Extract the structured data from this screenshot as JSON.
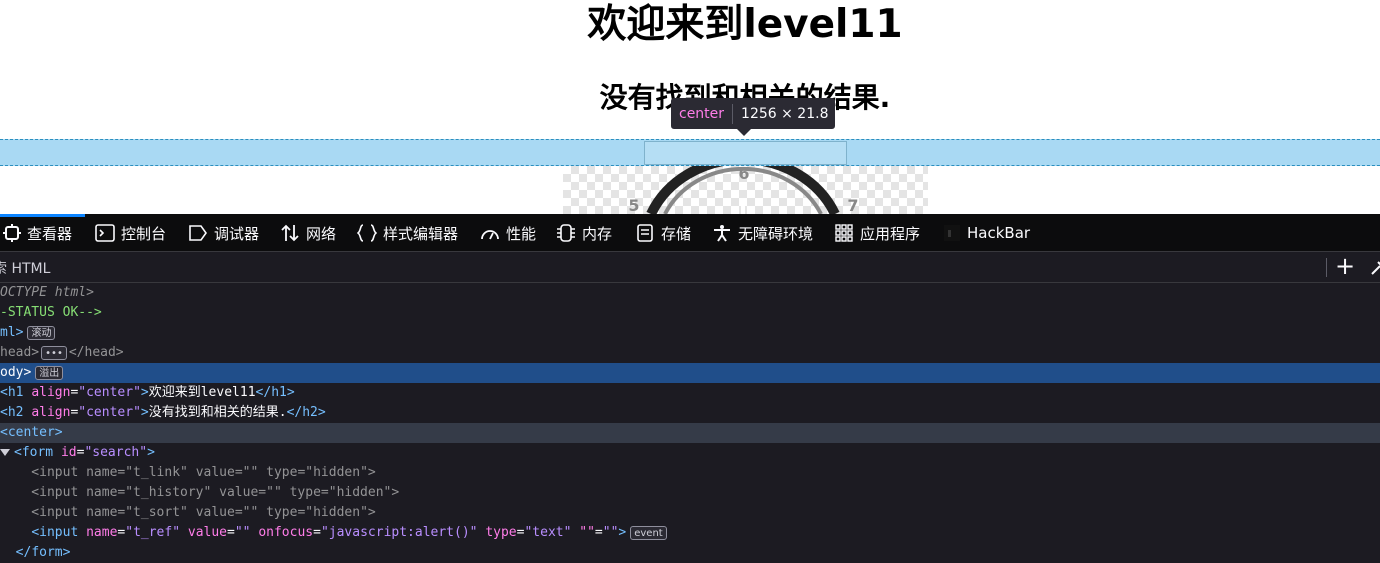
{
  "page": {
    "h1": "欢迎来到level11",
    "h2": "没有找到和相关的结果.",
    "tooltip": {
      "tag": "center",
      "dimensions": "1256 × 21.8"
    },
    "clock_digits": [
      "6",
      "5",
      "7"
    ]
  },
  "devtools": {
    "tabs": [
      {
        "label": "查看器",
        "icon": "inspector-icon"
      },
      {
        "label": "控制台",
        "icon": "console-icon"
      },
      {
        "label": "调试器",
        "icon": "debugger-icon"
      },
      {
        "label": "网络",
        "icon": "network-icon"
      },
      {
        "label": "样式编辑器",
        "icon": "style-editor-icon"
      },
      {
        "label": "性能",
        "icon": "performance-icon"
      },
      {
        "label": "内存",
        "icon": "memory-icon"
      },
      {
        "label": "存储",
        "icon": "storage-icon"
      },
      {
        "label": "无障碍环境",
        "icon": "accessibility-icon"
      },
      {
        "label": "应用程序",
        "icon": "application-icon"
      },
      {
        "label": "HackBar",
        "icon": "hackbar-icon"
      }
    ],
    "search_placeholder": "索 HTML",
    "add_label": "+",
    "tree": {
      "doctype": "OCTYPE html>",
      "comment": "-STATUS OK-->",
      "html_open": "ml>",
      "html_badge": "滚动",
      "head_open": "head>",
      "head_close": "</head>",
      "body_open": "ody>",
      "body_badge": "溢出",
      "h1": {
        "tag": "h1",
        "attr": "align",
        "val": "\"center\"",
        "text": "欢迎来到level11"
      },
      "h2": {
        "tag": "h2",
        "attr": "align",
        "val": "\"center\"",
        "text": "没有找到和相关的结果."
      },
      "center": "center",
      "form": {
        "tag": "form",
        "attr": "id",
        "val": "\"search\""
      },
      "inputs": [
        {
          "name": "\"t_link\"",
          "value": "\"\"",
          "type": "\"hidden\""
        },
        {
          "name": "\"t_history\"",
          "value": "\"\"",
          "type": "\"hidden\""
        },
        {
          "name": "\"t_sort\"",
          "value": "\"\"",
          "type": "\"hidden\""
        }
      ],
      "t_ref": {
        "name": "\"t_ref\"",
        "value": "\"\"",
        "onfocus": "\"javascript:alert()\"",
        "type": "\"text\"",
        "extra_attr": "\"\"",
        "extra_val": "\"\""
      },
      "event_badge": "event",
      "form_close": "form"
    }
  }
}
